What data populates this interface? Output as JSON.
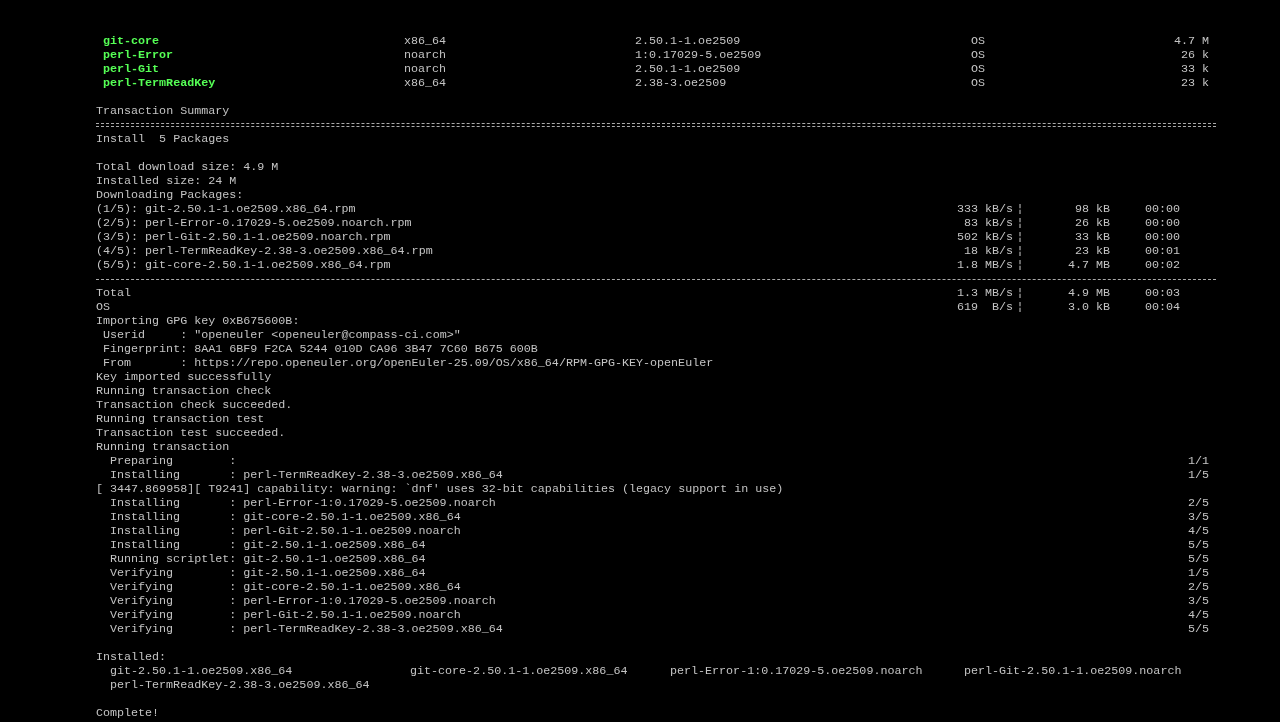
{
  "lines": [
    {
      "kind": "package",
      "name": "git-core",
      "arch": "x86_64",
      "version": "2.50.1-1.oe2509",
      "repo": "OS",
      "size": "4.7 M"
    },
    {
      "kind": "package",
      "name": "perl-Error",
      "arch": "noarch",
      "version": "1:0.17029-5.oe2509",
      "repo": "OS",
      "size": "26 k"
    },
    {
      "kind": "package",
      "name": "perl-Git",
      "arch": "noarch",
      "version": "2.50.1-1.oe2509",
      "repo": "OS",
      "size": "33 k"
    },
    {
      "kind": "package",
      "name": "perl-TermReadKey",
      "arch": "x86_64",
      "version": "2.38-3.oe2509",
      "repo": "OS",
      "size": "23 k"
    },
    {
      "kind": "blank"
    },
    {
      "kind": "text",
      "text": "Transaction Summary"
    },
    {
      "kind": "double_rule"
    },
    {
      "kind": "text",
      "text": "Install  5 Packages"
    },
    {
      "kind": "blank"
    },
    {
      "kind": "text",
      "text": "Total download size: 4.9 M"
    },
    {
      "kind": "text",
      "text": "Installed size: 24 M"
    },
    {
      "kind": "text",
      "text": "Downloading Packages:"
    },
    {
      "kind": "download",
      "label": "(1/5): git-2.50.1-1.oe2509.x86_64.rpm",
      "speed": "333 kB/s",
      "sep": "¦",
      "size": "98 kB",
      "time": "00:00"
    },
    {
      "kind": "download",
      "label": "(2/5): perl-Error-0.17029-5.oe2509.noarch.rpm",
      "speed": "83 kB/s",
      "sep": "¦",
      "size": "26 kB",
      "time": "00:00"
    },
    {
      "kind": "download",
      "label": "(3/5): perl-Git-2.50.1-1.oe2509.noarch.rpm",
      "speed": "502 kB/s",
      "sep": "¦",
      "size": "33 kB",
      "time": "00:00"
    },
    {
      "kind": "download",
      "label": "(4/5): perl-TermReadKey-2.38-3.oe2509.x86_64.rpm",
      "speed": "18 kB/s",
      "sep": "¦",
      "size": "23 kB",
      "time": "00:01"
    },
    {
      "kind": "download",
      "label": "(5/5): git-core-2.50.1-1.oe2509.x86_64.rpm",
      "speed": "1.8 MB/s",
      "sep": "¦",
      "size": "4.7 MB",
      "time": "00:02"
    },
    {
      "kind": "dashed_rule"
    },
    {
      "kind": "download",
      "label": "Total",
      "speed": "1.3 MB/s",
      "sep": "¦",
      "size": "4.9 MB",
      "time": "00:03"
    },
    {
      "kind": "download",
      "label": "OS",
      "speed": "619  B/s",
      "sep": "¦",
      "size": "3.0 kB",
      "time": "00:04"
    },
    {
      "kind": "text",
      "text": "Importing GPG key 0xB675600B:"
    },
    {
      "kind": "field",
      "label": "Userid     :",
      "value": "\"openeuler <openeuler@compass-ci.com>\""
    },
    {
      "kind": "field",
      "label": "Fingerprint:",
      "value": "8AA1 6BF9 F2CA 5244 010D CA96 3B47 7C60 B675 600B"
    },
    {
      "kind": "field",
      "label": "From       :",
      "value": "https://repo.openeuler.org/openEuler-25.09/OS/x86_64/RPM-GPG-KEY-openEuler"
    },
    {
      "kind": "text",
      "text": "Key imported successfully"
    },
    {
      "kind": "text",
      "text": "Running transaction check"
    },
    {
      "kind": "text",
      "text": "Transaction check succeeded."
    },
    {
      "kind": "text",
      "text": "Running transaction test"
    },
    {
      "kind": "text",
      "text": "Transaction test succeeded."
    },
    {
      "kind": "text",
      "text": "Running transaction"
    },
    {
      "kind": "step",
      "action": "Preparing        :",
      "counter": "1/1"
    },
    {
      "kind": "step",
      "action": "Installing       :",
      "package": "perl-TermReadKey-2.38-3.oe2509.x86_64",
      "counter": "1/5"
    },
    {
      "kind": "text",
      "text": "[ 3447.869958][ T9241] capability: warning: `dnf' uses 32-bit capabilities (legacy support in use)"
    },
    {
      "kind": "step",
      "action": "Installing       :",
      "package": "perl-Error-1:0.17029-5.oe2509.noarch",
      "counter": "2/5"
    },
    {
      "kind": "step",
      "action": "Installing       :",
      "package": "git-core-2.50.1-1.oe2509.x86_64",
      "counter": "3/5"
    },
    {
      "kind": "step",
      "action": "Installing       :",
      "package": "perl-Git-2.50.1-1.oe2509.noarch",
      "counter": "4/5"
    },
    {
      "kind": "step",
      "action": "Installing       :",
      "package": "git-2.50.1-1.oe2509.x86_64",
      "counter": "5/5"
    },
    {
      "kind": "step",
      "action": "Running scriptlet:",
      "package": "git-2.50.1-1.oe2509.x86_64",
      "counter": "5/5"
    },
    {
      "kind": "step",
      "action": "Verifying        :",
      "package": "git-2.50.1-1.oe2509.x86_64",
      "counter": "1/5"
    },
    {
      "kind": "step",
      "action": "Verifying        :",
      "package": "git-core-2.50.1-1.oe2509.x86_64",
      "counter": "2/5"
    },
    {
      "kind": "step",
      "action": "Verifying        :",
      "package": "perl-Error-1:0.17029-5.oe2509.noarch",
      "counter": "3/5"
    },
    {
      "kind": "step",
      "action": "Verifying        :",
      "package": "perl-Git-2.50.1-1.oe2509.noarch",
      "counter": "4/5"
    },
    {
      "kind": "step",
      "action": "Verifying        :",
      "package": "perl-TermReadKey-2.38-3.oe2509.x86_64",
      "counter": "5/5"
    },
    {
      "kind": "blank"
    },
    {
      "kind": "text",
      "text": "Installed:"
    },
    {
      "kind": "installed",
      "items": [
        "git-2.50.1-1.oe2509.x86_64",
        "git-core-2.50.1-1.oe2509.x86_64",
        "perl-Error-1:0.17029-5.oe2509.noarch",
        "perl-Git-2.50.1-1.oe2509.noarch",
        "perl-TermReadKey-2.38-3.oe2509.x86_64"
      ]
    },
    {
      "kind": "blank"
    },
    {
      "kind": "text",
      "text": "Complete!"
    }
  ]
}
